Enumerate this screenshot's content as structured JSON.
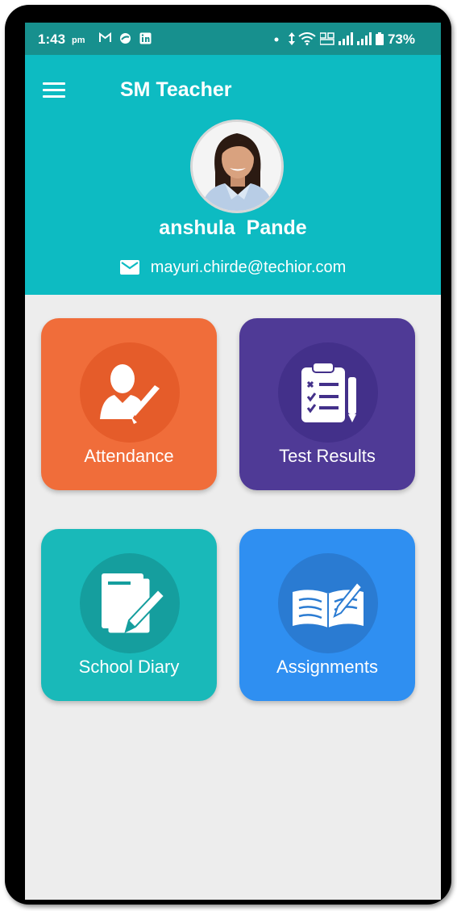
{
  "status": {
    "time": "1:43",
    "ampm": "pm",
    "battery": "73%",
    "left_icons": [
      "gmail-icon",
      "notification-icon",
      "linkedin-icon"
    ],
    "right_icons": [
      "dot-icon",
      "data-arrows-icon",
      "wifi-icon",
      "volte-icon",
      "signal-icon",
      "signal-icon",
      "battery-icon"
    ]
  },
  "header": {
    "title": "SM Teacher",
    "user_name": "anshula  Pande",
    "email": "mayuri.chirde@techior.com"
  },
  "tiles": [
    {
      "label": "Attendance",
      "icon": "attendance-person-check-icon",
      "color": "#f06d3a"
    },
    {
      "label": "Test Results",
      "icon": "clipboard-checklist-icon",
      "color": "#4f3a96"
    },
    {
      "label": "School Diary",
      "icon": "diary-pen-icon",
      "color": "#19b9b9"
    },
    {
      "label": "Assignments",
      "icon": "open-book-pen-icon",
      "color": "#2f8ff1"
    }
  ],
  "colors": {
    "header": "#0dbbc2",
    "statusbar": "#17908e",
    "background": "#ededed"
  }
}
